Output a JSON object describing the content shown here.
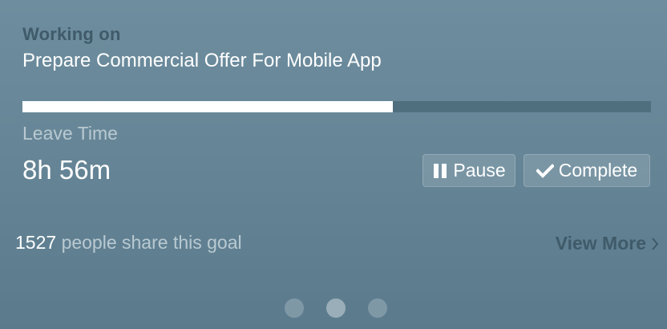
{
  "header": {
    "working_label": "Working on",
    "task_title": "Prepare Commercial Offer For Mobile App"
  },
  "progress": {
    "fraction": 0.589,
    "fill_color": "#ffffff",
    "track_color": "#4f6e7e"
  },
  "timer": {
    "label": "Leave Time",
    "value": "8h 56m"
  },
  "actions": {
    "pause": {
      "label": "Pause",
      "icon": "pause-icon"
    },
    "complete": {
      "label": "Complete",
      "icon": "check-icon"
    }
  },
  "share": {
    "count": "1527",
    "label": "people share this goal"
  },
  "view_more": {
    "label": "View More",
    "icon": "chevron-right-icon"
  },
  "pager": {
    "active_index": 1,
    "count": 3
  },
  "colors": {
    "accent_dark": "#3f5a69",
    "muted_text": "#b9c9d1"
  }
}
